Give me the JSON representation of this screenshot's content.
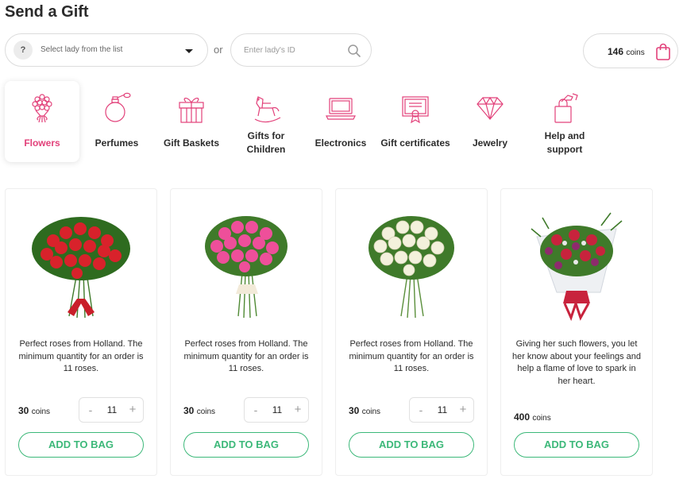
{
  "page": {
    "title": "Send a Gift"
  },
  "selector": {
    "icon_label": "?",
    "placeholder": "Select lady from the list",
    "or_label": "or",
    "id_placeholder": "Enter lady's ID"
  },
  "wallet": {
    "amount": "146",
    "unit": "coins"
  },
  "categories": [
    {
      "label": "Flowers",
      "icon": "flower-bouquet-icon",
      "active": true
    },
    {
      "label": "Perfumes",
      "icon": "perfume-icon",
      "active": false
    },
    {
      "label": "Gift Baskets",
      "icon": "gift-basket-icon",
      "active": false
    },
    {
      "label": "Gifts for Children",
      "icon": "rocking-horse-icon",
      "active": false
    },
    {
      "label": "Electronics",
      "icon": "laptop-icon",
      "active": false
    },
    {
      "label": "Gift certificates",
      "icon": "certificate-icon",
      "active": false
    },
    {
      "label": "Jewelry",
      "icon": "diamond-icon",
      "active": false
    },
    {
      "label": "Help and support",
      "icon": "help-support-icon",
      "active": false
    }
  ],
  "products": [
    {
      "description": "Perfect roses from Holland. The minimum quantity for an order is 11 roses.",
      "price": "30",
      "unit": "coins",
      "quantity": "11",
      "has_quantity": true,
      "button": "ADD TO BAG",
      "flower_color": "#d8222b"
    },
    {
      "description": "Perfect roses from Holland. The minimum quantity for an order is 11 roses.",
      "price": "30",
      "unit": "coins",
      "quantity": "11",
      "has_quantity": true,
      "button": "ADD TO BAG",
      "flower_color": "#ee4f9a"
    },
    {
      "description": "Perfect roses from Holland. The minimum quantity for an order is 11 roses.",
      "price": "30",
      "unit": "coins",
      "quantity": "11",
      "has_quantity": true,
      "button": "ADD TO BAG",
      "flower_color": "#f3f1dc"
    },
    {
      "description": "Giving her such flowers, you let her know about your feelings and help a flame of love to spark in her heart.",
      "price": "400",
      "unit": "coins",
      "quantity": "",
      "has_quantity": false,
      "button": "ADD TO BAG",
      "flower_color": "#c8233d"
    }
  ],
  "colors": {
    "accent": "#e2417a",
    "button_green": "#3cb879",
    "icon_pink": "#e2417a"
  },
  "icons": {
    "search": "search-icon",
    "bag": "shopping-bag-icon",
    "caret": "chevron-down-icon"
  }
}
